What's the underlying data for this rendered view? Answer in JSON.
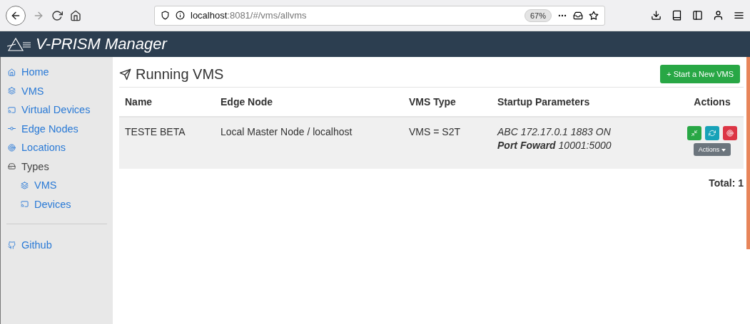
{
  "browser": {
    "url_host": "localhost",
    "url_path": ":8081/#/vms/allvms",
    "zoom": "67%"
  },
  "app": {
    "title": "V-PRISM Manager"
  },
  "sidebar": {
    "items": [
      {
        "label": "Home",
        "kind": "link"
      },
      {
        "label": "VMS",
        "kind": "link"
      },
      {
        "label": "Virtual Devices",
        "kind": "link"
      },
      {
        "label": "Edge Nodes",
        "kind": "link"
      },
      {
        "label": "Locations",
        "kind": "link"
      },
      {
        "label": "Types",
        "kind": "group",
        "children": [
          {
            "label": "VMS",
            "kind": "link"
          },
          {
            "label": "Devices",
            "kind": "link"
          }
        ]
      }
    ],
    "footer_items": [
      {
        "label": "Github",
        "kind": "link"
      }
    ]
  },
  "page": {
    "title": "Running VMS",
    "new_button": "+ Start a New VMS"
  },
  "table": {
    "columns": [
      "Name",
      "Edge Node",
      "VMS Type",
      "Startup Parameters",
      "Actions"
    ],
    "rows": [
      {
        "name": "TESTE BETA",
        "edge_node": "Local Master Node / localhost",
        "vms_type": "VMS = S2T",
        "parameters": [
          "ABC 172.17.0.1 1883 ON",
          "**Port Foward** 10001:5000"
        ],
        "actions_menu": "Actions"
      }
    ]
  },
  "total": "Total: 1"
}
